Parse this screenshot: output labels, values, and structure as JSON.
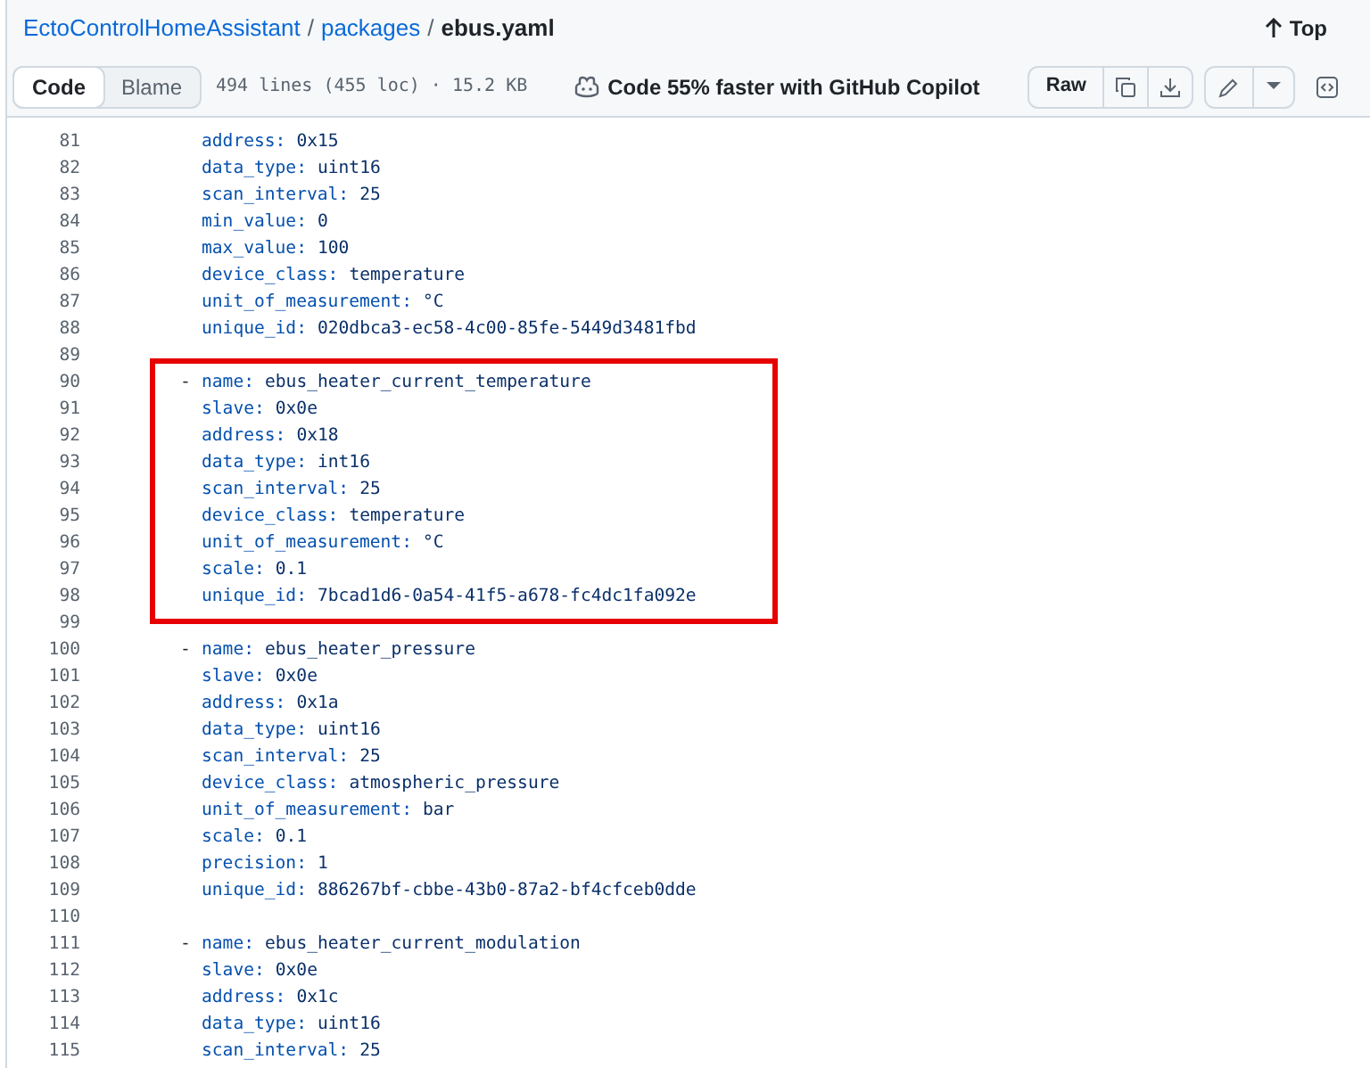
{
  "breadcrumb": {
    "repo": "EctoControlHomeAssistant",
    "sep1": "/",
    "folder": "packages",
    "sep2": "/",
    "file": "ebus.yaml"
  },
  "top_link": "Top",
  "view_tabs": [
    {
      "label": "Code",
      "selected": true
    },
    {
      "label": "Blame",
      "selected": false
    }
  ],
  "file_info": "494 lines (455 loc) · 15.2 KB",
  "copilot_text": "Code 55% faster with GitHub Copilot",
  "raw_button": "Raw",
  "blocks": [
    {
      "highlighted": false,
      "lines": [
        {
          "n": "81",
          "key": "address:",
          "value": "0x15"
        },
        {
          "n": "82",
          "key": "data_type:",
          "value": "uint16"
        },
        {
          "n": "83",
          "key": "scan_interval:",
          "value": "25"
        },
        {
          "n": "84",
          "key": "min_value:",
          "value": "0"
        },
        {
          "n": "85",
          "key": "max_value:",
          "value": "100"
        },
        {
          "n": "86",
          "key": "device_class:",
          "value": "temperature"
        },
        {
          "n": "87",
          "key": "unit_of_measurement:",
          "value": "°C"
        },
        {
          "n": "88",
          "key": "unique_id:",
          "value": "020dbca3-ec58-4c00-85fe-5449d3481fbd"
        },
        {
          "n": "89"
        }
      ]
    },
    {
      "highlighted": true,
      "lines": [
        {
          "n": "90",
          "dash": "-",
          "key": "name:",
          "value": "ebus_heater_current_temperature"
        },
        {
          "n": "91",
          "key": "slave:",
          "value": "0x0e"
        },
        {
          "n": "92",
          "key": "address:",
          "value": "0x18"
        },
        {
          "n": "93",
          "key": "data_type:",
          "value": "int16"
        },
        {
          "n": "94",
          "key": "scan_interval:",
          "value": "25"
        },
        {
          "n": "95",
          "key": "device_class:",
          "value": "temperature"
        },
        {
          "n": "96",
          "key": "unit_of_measurement:",
          "value": "°C"
        },
        {
          "n": "97",
          "key": "scale:",
          "value": "0.1"
        },
        {
          "n": "98",
          "key": "unique_id:",
          "value": "7bcad1d6-0a54-41f5-a678-fc4dc1fa092e"
        }
      ]
    },
    {
      "highlighted": false,
      "lines": [
        {
          "n": "99"
        },
        {
          "n": "100",
          "dash": "-",
          "key": "name:",
          "value": "ebus_heater_pressure"
        },
        {
          "n": "101",
          "key": "slave:",
          "value": "0x0e"
        },
        {
          "n": "102",
          "key": "address:",
          "value": "0x1a"
        },
        {
          "n": "103",
          "key": "data_type:",
          "value": "uint16"
        },
        {
          "n": "104",
          "key": "scan_interval:",
          "value": "25"
        },
        {
          "n": "105",
          "key": "device_class:",
          "value": "atmospheric_pressure"
        },
        {
          "n": "106",
          "key": "unit_of_measurement:",
          "value": "bar"
        },
        {
          "n": "107",
          "key": "scale:",
          "value": "0.1"
        },
        {
          "n": "108",
          "key": "precision:",
          "value": "1"
        },
        {
          "n": "109",
          "key": "unique_id:",
          "value": "886267bf-cbbe-43b0-87a2-bf4cfceb0dde"
        },
        {
          "n": "110"
        },
        {
          "n": "111",
          "dash": "-",
          "key": "name:",
          "value": "ebus_heater_current_modulation"
        },
        {
          "n": "112",
          "key": "slave:",
          "value": "0x0e"
        },
        {
          "n": "113",
          "key": "address:",
          "value": "0x1c"
        },
        {
          "n": "114",
          "key": "data_type:",
          "value": "uint16"
        },
        {
          "n": "115",
          "key": "scan_interval:",
          "value": "25"
        }
      ]
    }
  ]
}
